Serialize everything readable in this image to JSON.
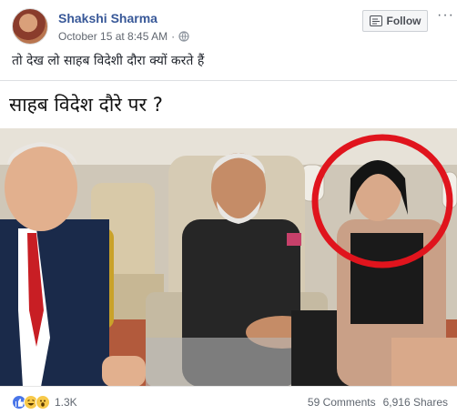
{
  "post": {
    "author": "Shakshi Sharma",
    "timestamp": "October 15 at 8:45 AM",
    "separator": "·",
    "privacy_icon": "globe-icon",
    "follow_label": "Follow",
    "more_label": "···",
    "text": "तो देख लो साहब विदेशी दौरा क्यों करते हैं",
    "image_caption": "साहब विदेश दौरे पर ?"
  },
  "footer": {
    "reaction_icons": [
      "like-icon",
      "haha-icon",
      "wow-icon"
    ],
    "reaction_count": "1.3K",
    "comments": "59 Comments",
    "shares": "6,916 Shares"
  },
  "colors": {
    "author_link": "#385898",
    "like_blue": "#4a76e8",
    "highlight_circle": "#e0141d"
  }
}
